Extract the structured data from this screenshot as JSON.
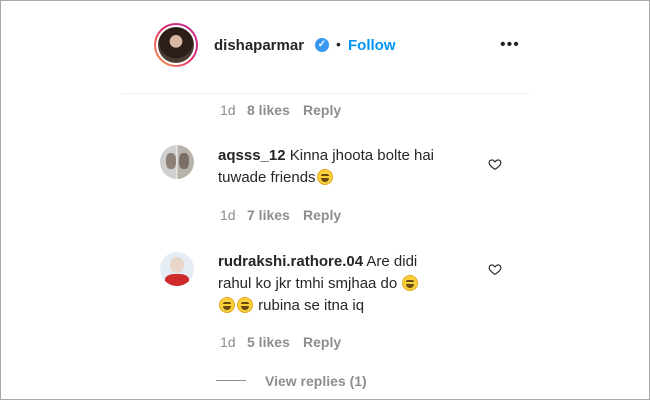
{
  "header": {
    "username": "dishaparmar",
    "separator": "•",
    "follow_label": "Follow",
    "more_label": "•••"
  },
  "top_meta": {
    "time": "1d",
    "likes": "8 likes",
    "reply": "Reply"
  },
  "comments": [
    {
      "username": "aqsss_12",
      "line1": "Kinna jhoota bolte hai",
      "line2": "tuwade friends",
      "time": "1d",
      "likes": "7 likes",
      "reply": "Reply"
    },
    {
      "username": "rudrakshi.rathore.04",
      "line1": "Are didi",
      "line2": "rahul ko jkr tmhi smjhaa do",
      "line3": "rubina se itna iq",
      "time": "1d",
      "likes": "5 likes",
      "reply": "Reply"
    }
  ],
  "view_replies": "View replies (1)",
  "icons": {
    "verified": "verified-badge-icon",
    "heart": "heart-outline-icon",
    "emoji": "face-with-tears-of-joy-emoji"
  },
  "colors": {
    "link": "#0095f6",
    "verified": "#3897f0",
    "muted": "#8e8e8e"
  }
}
